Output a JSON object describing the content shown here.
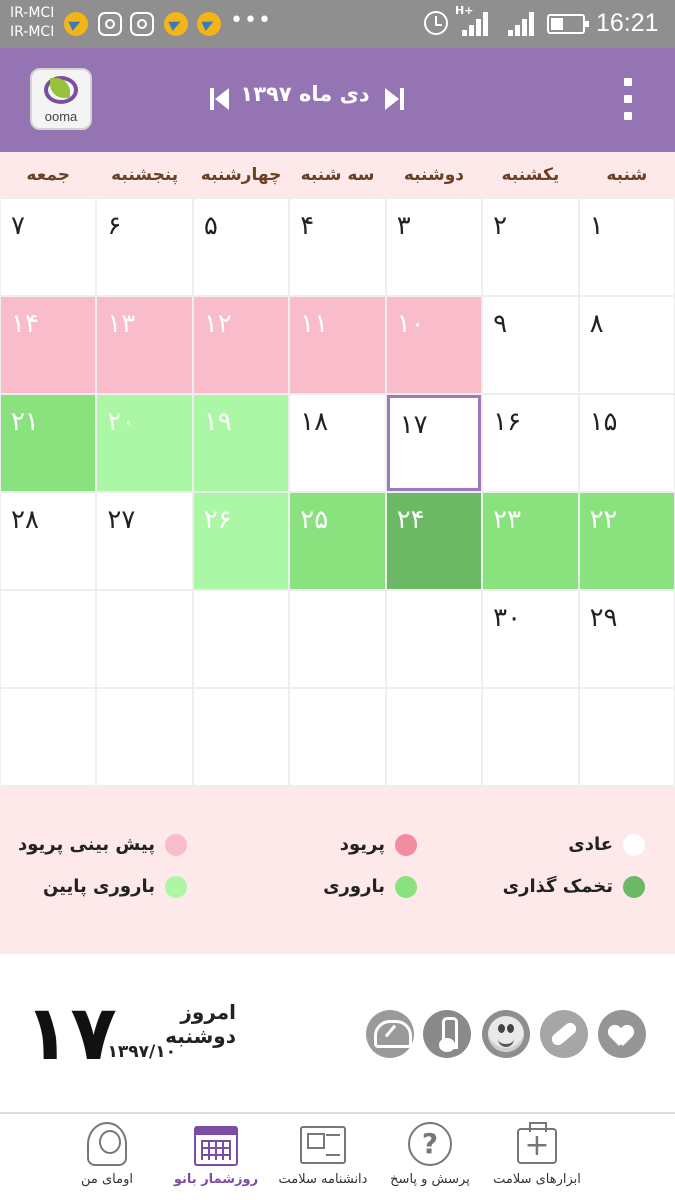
{
  "status_bar": {
    "carrier_1": "IR-MCI",
    "carrier_2": "IR-MCI",
    "network": "H+",
    "time": "16:21",
    "dots": "•••"
  },
  "header": {
    "logo_text": "ooma",
    "month_title": "دی ماه ۱۳۹۷",
    "brand_color": "#9474b2"
  },
  "weekdays": [
    "شنبه",
    "یکشنبه",
    "دوشنبه",
    "سه شنبه",
    "چهارشنبه",
    "پنجشنبه",
    "جمعه"
  ],
  "calendar": {
    "weeks": [
      [
        {
          "d": "۱",
          "t": "normal"
        },
        {
          "d": "۲",
          "t": "normal"
        },
        {
          "d": "۳",
          "t": "normal"
        },
        {
          "d": "۴",
          "t": "normal"
        },
        {
          "d": "۵",
          "t": "normal"
        },
        {
          "d": "۶",
          "t": "normal"
        },
        {
          "d": "۷",
          "t": "normal"
        }
      ],
      [
        {
          "d": "۸",
          "t": "normal"
        },
        {
          "d": "۹",
          "t": "normal"
        },
        {
          "d": "۱۰",
          "t": "period-pred"
        },
        {
          "d": "۱۱",
          "t": "period-pred"
        },
        {
          "d": "۱۲",
          "t": "period-pred"
        },
        {
          "d": "۱۳",
          "t": "period-pred"
        },
        {
          "d": "۱۴",
          "t": "period-pred"
        }
      ],
      [
        {
          "d": "۱۵",
          "t": "normal"
        },
        {
          "d": "۱۶",
          "t": "normal"
        },
        {
          "d": "۱۷",
          "t": "today"
        },
        {
          "d": "۱۸",
          "t": "normal"
        },
        {
          "d": "۱۹",
          "t": "low"
        },
        {
          "d": "۲۰",
          "t": "low"
        },
        {
          "d": "۲۱",
          "t": "fertile"
        }
      ],
      [
        {
          "d": "۲۲",
          "t": "fertile"
        },
        {
          "d": "۲۳",
          "t": "fertile"
        },
        {
          "d": "۲۴",
          "t": "ovulation"
        },
        {
          "d": "۲۵",
          "t": "fertile"
        },
        {
          "d": "۲۶",
          "t": "low"
        },
        {
          "d": "۲۷",
          "t": "normal"
        },
        {
          "d": "۲۸",
          "t": "normal"
        }
      ],
      [
        {
          "d": "۲۹",
          "t": "normal"
        },
        {
          "d": "۳۰",
          "t": "normal"
        },
        {
          "d": "",
          "t": "normal"
        },
        {
          "d": "",
          "t": "normal"
        },
        {
          "d": "",
          "t": "normal"
        },
        {
          "d": "",
          "t": "normal"
        },
        {
          "d": "",
          "t": "normal"
        }
      ],
      [
        {
          "d": "",
          "t": "normal"
        },
        {
          "d": "",
          "t": "normal"
        },
        {
          "d": "",
          "t": "normal"
        },
        {
          "d": "",
          "t": "normal"
        },
        {
          "d": "",
          "t": "normal"
        },
        {
          "d": "",
          "t": "normal"
        },
        {
          "d": "",
          "t": "normal"
        }
      ]
    ]
  },
  "legend": {
    "items": [
      {
        "label": "عادی",
        "color": "#ffffff"
      },
      {
        "label": "پریود",
        "color": "#f48ca1"
      },
      {
        "label": "پیش بینی پریود",
        "color": "#f9bccb"
      },
      {
        "label": "تخمک گذاری",
        "color": "#6bb865"
      },
      {
        "label": "باروری",
        "color": "#8ae27e"
      },
      {
        "label": "باروری پایین",
        "color": "#acf7a5"
      }
    ]
  },
  "today": {
    "big_day": "۱۷",
    "title": "امروز دوشنبه",
    "date": "۱۳۹۷/۱۰"
  },
  "tools": [
    "heart-icon",
    "pill-icon",
    "mood-icon",
    "thermometer-icon",
    "scale-icon"
  ],
  "bottom_nav": [
    {
      "label": "ابزارهای سلامت",
      "icon": "first-aid-kit-icon",
      "active": false
    },
    {
      "label": "پرسش و پاسخ",
      "icon": "question-bubble-icon",
      "active": false
    },
    {
      "label": "دانشنامه سلامت",
      "icon": "newspaper-icon",
      "active": false
    },
    {
      "label": "روزشمار بانو",
      "icon": "calendar-icon",
      "active": true
    },
    {
      "label": "اومای من",
      "icon": "user-icon",
      "active": false
    }
  ]
}
